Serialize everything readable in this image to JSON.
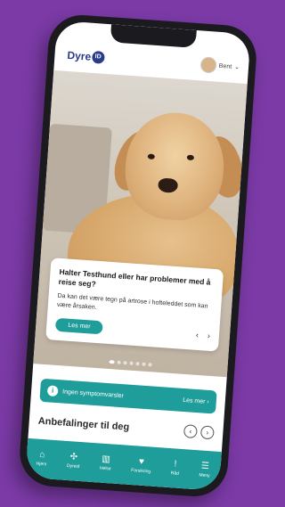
{
  "header": {
    "logo_text": "Dyre",
    "logo_badge": "ID",
    "user_name": "Bent"
  },
  "card": {
    "title": "Halter Testhund eller har problemer med å reise seg?",
    "body": "Da kan det være tegn på artrose i hofteleddet som kan være årsaken.",
    "button_label": "Les mer",
    "prev_icon": "chevron-left-icon",
    "next_icon": "chevron-right-icon"
  },
  "carousel": {
    "dot_count": 7,
    "active_index": 0
  },
  "symptom_banner": {
    "label": "Ingen symptomvarsler",
    "more": "Les mer"
  },
  "recommendations": {
    "title": "Anbefalinger til deg"
  },
  "tabbar": {
    "items": [
      {
        "label": "Hjem",
        "icon": "home-icon"
      },
      {
        "label": "Dyreid",
        "icon": "pet-icon"
      },
      {
        "label": "Helse",
        "icon": "chart-icon"
      },
      {
        "label": "Forsikring",
        "icon": "heart-icon"
      },
      {
        "label": "Råd",
        "icon": "info-icon"
      },
      {
        "label": "Meny",
        "icon": "menu-icon"
      }
    ]
  },
  "colors": {
    "background": "#7b3aa6",
    "accent": "#1f9d9a",
    "brand": "#2a3a8c"
  }
}
